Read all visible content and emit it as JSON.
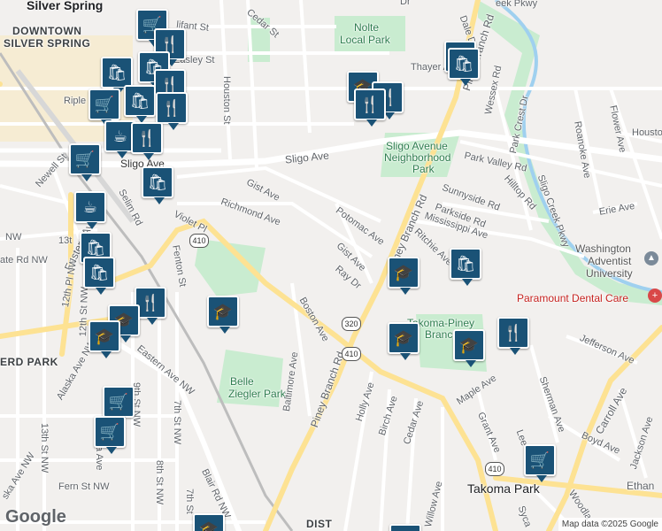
{
  "places": {
    "silver_spring": "Silver Spring",
    "downtown_1": "DOWNTOWN",
    "downtown_2": "SILVER SPRING",
    "takoma_park": "Takoma Park",
    "erd_park": "ERD PARK",
    "dist": "DIST"
  },
  "parks": {
    "nolte_1": "Nolte",
    "nolte_2": "Local Park",
    "sligo_1": "Sligo Avenue",
    "sligo_2": "Neighborhood",
    "sligo_3": "Park",
    "belle_1": "Belle",
    "belle_2": "Ziegler Park",
    "takoma_piney_1": "Takoma-Piney",
    "takoma_piney_2": "Branch"
  },
  "pois": {
    "adventist_1": "Washington",
    "adventist_2": "Adventist",
    "adventist_3": "University",
    "dental": "Paramount Dental Care"
  },
  "streets": {
    "sligo_ave": "Sligo Ave",
    "sligo_ave_w": "Sligo Ave",
    "piney_branch_n": "Piney Branch Rd",
    "piney_branch_m": "Piney Branch Rd",
    "piney_branch_s": "Piney Branch Rd",
    "dale_dr": "Dale Dr",
    "cedar_st_n": "Cedar St",
    "houston_st": "Houston St",
    "easley_st": "Easley St",
    "thayer_ave": "Thayer Ave",
    "wessex_rd": "Wessex Rd",
    "park_crest_dr": "Park Crest Dr",
    "park_valley_rd": "Park Valley Rd",
    "sunnyside_rd": "Sunnyside Rd",
    "parkside_rd": "Parkside Rd",
    "mississippi_ave": "Mississippi Ave",
    "ritchie_ave": "Ritchie Ave",
    "hilltop_rd": "Hilltop Rd",
    "sligo_creek_pkwy": "Sligo Creek Pkwy",
    "creek_pkwy": "eek Pkwy",
    "roanoke_ave": "Roanoke Ave",
    "flower_ave": "Flower Ave",
    "houston_e": "Housto",
    "erie_ave": "Erie Ave",
    "gist_ave_n": "Gist Ave",
    "gist_ave_s": "Gist Ave",
    "richmond_ave": "Richmond Ave",
    "potomac_ave": "Potomac Ave",
    "ray_dr": "Ray Dr",
    "violet_pl": "Violet Pl",
    "fenton_st": "Fenton St",
    "selim_rd": "Selim Rd",
    "newell_st": "Newell St",
    "boston_ave": "Boston Ave",
    "baltimore_ave": "Baltimore Ave",
    "holly_ave": "Holly Ave",
    "birch_ave": "Birch Ave",
    "cedar_ave": "Cedar Ave",
    "willow_ave": "Willow Ave",
    "maple_ave": "Maple Ave",
    "grant_ave": "Grant Ave",
    "sherman_ave": "Sherman Ave",
    "lee": "Lee",
    "carroll_ave": "Carroll Ave",
    "boyd_ave": "Boyd Ave",
    "jackson_ave": "Jackson Ave",
    "jefferson_ave": "Jefferson Ave",
    "ethan": "Ethan",
    "woodla": "Woodla",
    "syca": "Syca",
    "eastern_ave": "Eastern Ave",
    "eastern_ave_nw": "Eastern Ave NW",
    "alaska_ave_nw": "Alaska Ave NW",
    "ska_ave_nw": "ska Ave NW",
    "th12_pl_nw": "12th Pl NW",
    "th12_st_nw": "12th St NW",
    "th13_st_nw": "13th St NW",
    "th13": "13t",
    "th9_st_nw": "9th St NW",
    "th8_st_nw": "8th St NW",
    "th7_st_nw": "7th St NW",
    "th7_st": "7th St",
    "blair_rd_nw": "Blair Rd NW",
    "fern_st_nw": "Fern St NW",
    "ate_rd_nw": "ate Rd NW",
    "nw": "NW",
    "ripley": "Riple",
    "ga_ave": "a Ave",
    "dale_top": "Dr",
    "olifant": "lifant St"
  },
  "shields": {
    "r410_w": "410",
    "r410_m": "410",
    "r410_s": "410",
    "r320": "320"
  },
  "pins": [
    {
      "type": "shopping-cart",
      "glyph": "🛒"
    },
    {
      "type": "restaurant",
      "glyph": "🍴"
    },
    {
      "type": "shopping-bag",
      "glyph": "🛍"
    },
    {
      "type": "cafe",
      "glyph": "☕"
    },
    {
      "type": "school",
      "glyph": "🎓"
    }
  ],
  "attribution": "Map data ©2025 Google",
  "logo": "Google"
}
